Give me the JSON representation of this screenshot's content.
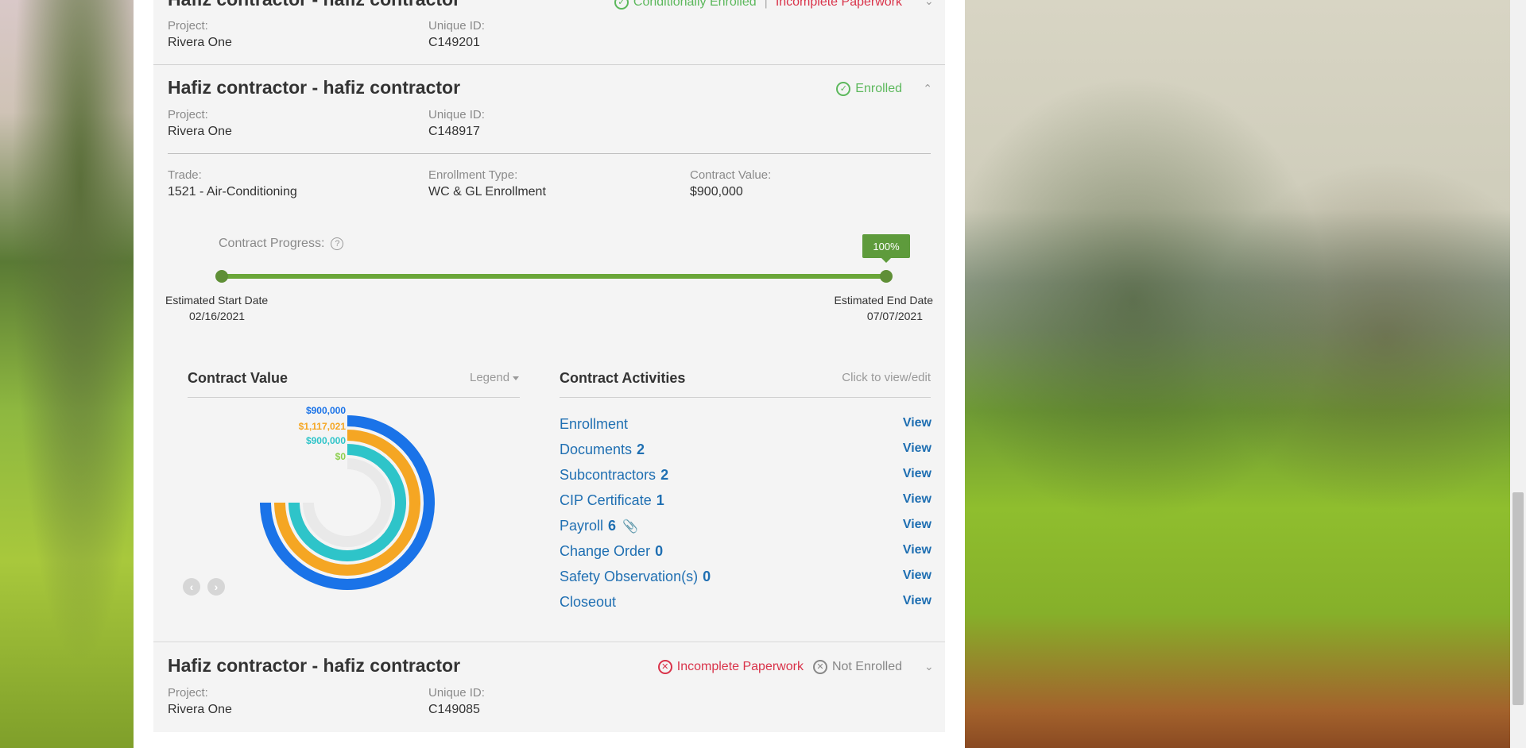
{
  "cards": [
    {
      "title": "Hafiz contractor - hafiz contractor",
      "status_ok": "Conditionally Enrolled",
      "status_sep": "|",
      "status_bad": "Incomplete Paperwork",
      "project_label": "Project:",
      "project": "Rivera One",
      "uid_label": "Unique ID:",
      "uid": "C149201"
    },
    {
      "title": "Hafiz contractor - hafiz contractor",
      "status_ok": "Enrolled",
      "project_label": "Project:",
      "project": "Rivera One",
      "uid_label": "Unique ID:",
      "uid": "C148917",
      "trade_label": "Trade:",
      "trade": "1521 - Air-Conditioning",
      "enroll_type_label": "Enrollment Type:",
      "enroll_type": "WC & GL Enrollment",
      "contract_value_label": "Contract Value:",
      "contract_value": "$900,000",
      "progress": {
        "label": "Contract Progress:",
        "help_icon": "question-circle-icon",
        "percent_text": "100%",
        "fraction": 1.0,
        "start_label": "Estimated Start Date",
        "start_date": "02/16/2021",
        "end_label": "Estimated End Date",
        "end_date": "07/07/2021"
      },
      "contract_value_section": {
        "title": "Contract Value",
        "legend_label": "Legend"
      },
      "activities_section": {
        "title": "Contract Activities",
        "hint": "Click to view/edit",
        "items": [
          {
            "name": "Enrollment",
            "count": "",
            "view": "View"
          },
          {
            "name": "Documents",
            "count": "2",
            "view": "View"
          },
          {
            "name": "Subcontractors",
            "count": "2",
            "view": "View"
          },
          {
            "name": "CIP Certificate",
            "count": "1",
            "view": "View"
          },
          {
            "name": "Payroll",
            "count": "6",
            "view": "View",
            "icon": "paperclip-icon"
          },
          {
            "name": "Change Order",
            "count": "0",
            "view": "View"
          },
          {
            "name": "Safety Observation(s)",
            "count": "0",
            "view": "View"
          },
          {
            "name": "Closeout",
            "count": "",
            "view": "View"
          }
        ]
      }
    },
    {
      "title": "Hafiz contractor - hafiz contractor",
      "status_bad": "Incomplete Paperwork",
      "status_gray": "Not Enrolled",
      "project_label": "Project:",
      "project": "Rivera One",
      "uid_label": "Unique ID:",
      "uid": "C149085"
    }
  ],
  "chart_data": {
    "type": "radial-bar",
    "series": [
      {
        "label": "$900,000",
        "value": 900000,
        "fraction": 0.75,
        "color": "#1a73e8"
      },
      {
        "label": "$1,117,021",
        "value": 1117021,
        "fraction": 0.75,
        "color": "#f5a623"
      },
      {
        "label": "$900,000",
        "value": 900000,
        "fraction": 0.75,
        "color": "#2ec4c9"
      },
      {
        "label": "$0",
        "value": 0,
        "fraction": 0.0,
        "color": "#8ccf4d"
      }
    ]
  },
  "colors": {
    "accent_blue": "#1f6fb2",
    "enrolled_green": "#5cb85c",
    "incomplete_red": "#d9334a",
    "progress_green": "#6aa639"
  }
}
